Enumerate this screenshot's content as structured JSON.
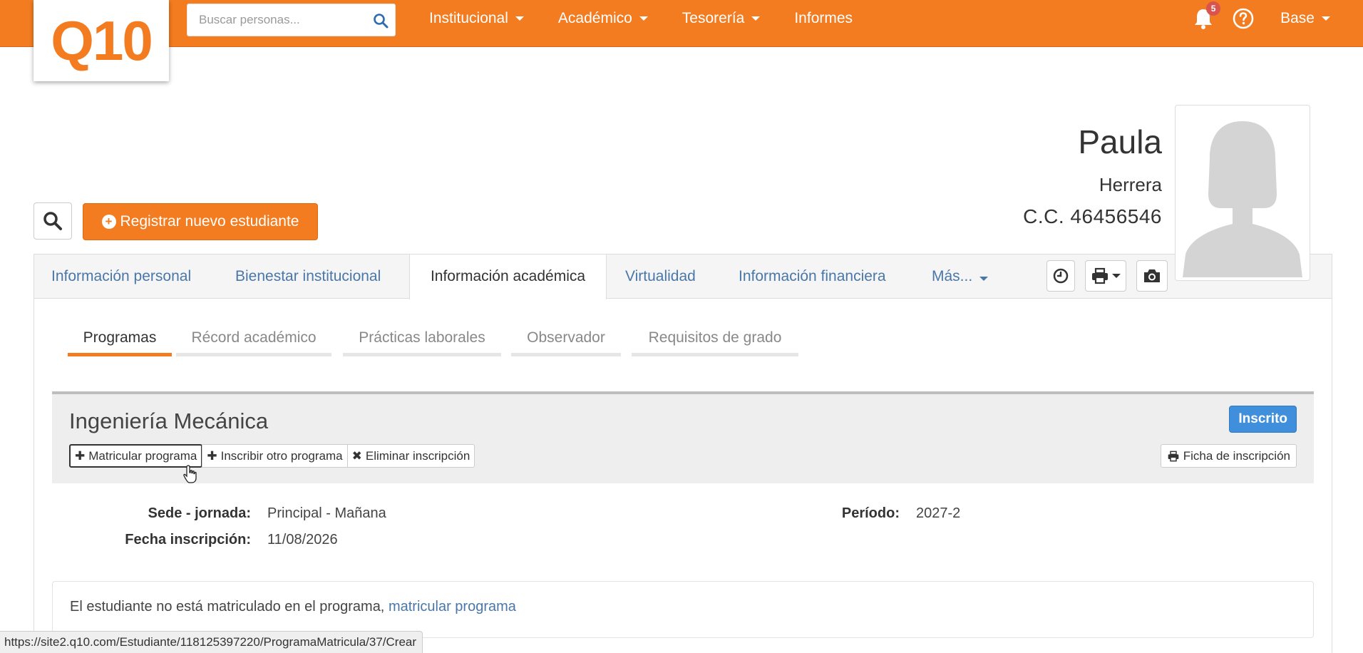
{
  "brand": {
    "logo": "Q10",
    "accent_color": "#f47c20"
  },
  "search": {
    "placeholder": "Buscar personas..."
  },
  "nav": {
    "items": [
      {
        "label": "Institucional",
        "dropdown": true
      },
      {
        "label": "Académico",
        "dropdown": true
      },
      {
        "label": "Tesorería",
        "dropdown": true
      },
      {
        "label": "Informes",
        "dropdown": false
      }
    ],
    "notifications_count": "5",
    "user_menu": "Base"
  },
  "actions": {
    "register_label": "Registrar nuevo estudiante"
  },
  "student": {
    "first_name": "Paula",
    "last_name": "Herrera",
    "document": "C.C. 46456546"
  },
  "tabs": [
    {
      "label": "Información personal",
      "active": false
    },
    {
      "label": "Bienestar institucional",
      "active": false
    },
    {
      "label": "Información académica",
      "active": true
    },
    {
      "label": "Virtualidad",
      "active": false
    },
    {
      "label": "Información financiera",
      "active": false
    },
    {
      "label": "Más...",
      "active": false
    }
  ],
  "subtabs": [
    {
      "label": "Programas",
      "active": true
    },
    {
      "label": "Récord académico",
      "active": false
    },
    {
      "label": "Prácticas laborales",
      "active": false
    },
    {
      "label": "Observador",
      "active": false
    },
    {
      "label": "Requisitos de grado",
      "active": false
    }
  ],
  "program": {
    "name": "Ingeniería Mecánica",
    "status": "Inscrito",
    "status_color": "#3f8fdc",
    "buttons": {
      "matricular": "Matricular programa",
      "inscribir": "Inscribir otro programa",
      "eliminar": "Eliminar inscripción",
      "ficha": "Ficha de inscripción"
    },
    "details": {
      "sede_label": "Sede - jornada:",
      "sede_value": "Principal - Mañana",
      "fecha_label": "Fecha inscripción:",
      "fecha_value": "11/08/2026",
      "periodo_label": "Período:",
      "periodo_value": "2027-2"
    },
    "notice_text": "El estudiante no está matriculado en el programa,",
    "notice_link": "matricular programa"
  },
  "statusbar": {
    "url": "https://site2.q10.com/Estudiante/118125397220/ProgramaMatricula/37/Crear"
  }
}
